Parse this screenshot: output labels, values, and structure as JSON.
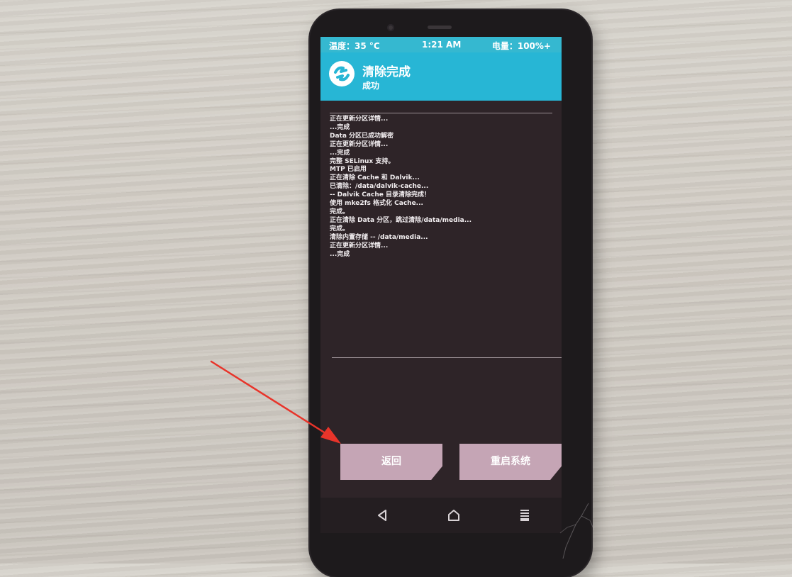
{
  "status_bar": {
    "temperature": "温度：35 °C",
    "time": "1:21 AM",
    "battery": "电量：100%+"
  },
  "header": {
    "title": "清除完成",
    "subtitle": "成功",
    "logo_icon": "twrp-logo-icon"
  },
  "console": {
    "lines": [
      "正在更新分区详情...",
      "...完成",
      "Data 分区已成功解密",
      "正在更新分区详情...",
      "...完成",
      "完整 SELinux 支持。",
      "MTP 已启用",
      "正在清除 Cache 和 Dalvik...",
      "已清除：/data/dalvik-cache...",
      "-- Dalvik Cache 目录清除完成！",
      "使用 mke2fs 格式化 Cache...",
      "完成。",
      "正在清除 Data 分区，跳过清除/data/media...",
      "完成。",
      "清除内置存储 -- /data/media...",
      "正在更新分区详情...",
      "...完成"
    ]
  },
  "buttons": {
    "back": "返回",
    "reboot": "重启系统"
  },
  "navbar": {
    "back_icon": "triangle-back-icon",
    "home_icon": "home-icon",
    "menu_icon": "menu-icon"
  },
  "colors": {
    "header": "#27b6d5",
    "button": "#c5a5b5",
    "console_bg": "#2e2428",
    "annotation_arrow": "#e8342a"
  }
}
